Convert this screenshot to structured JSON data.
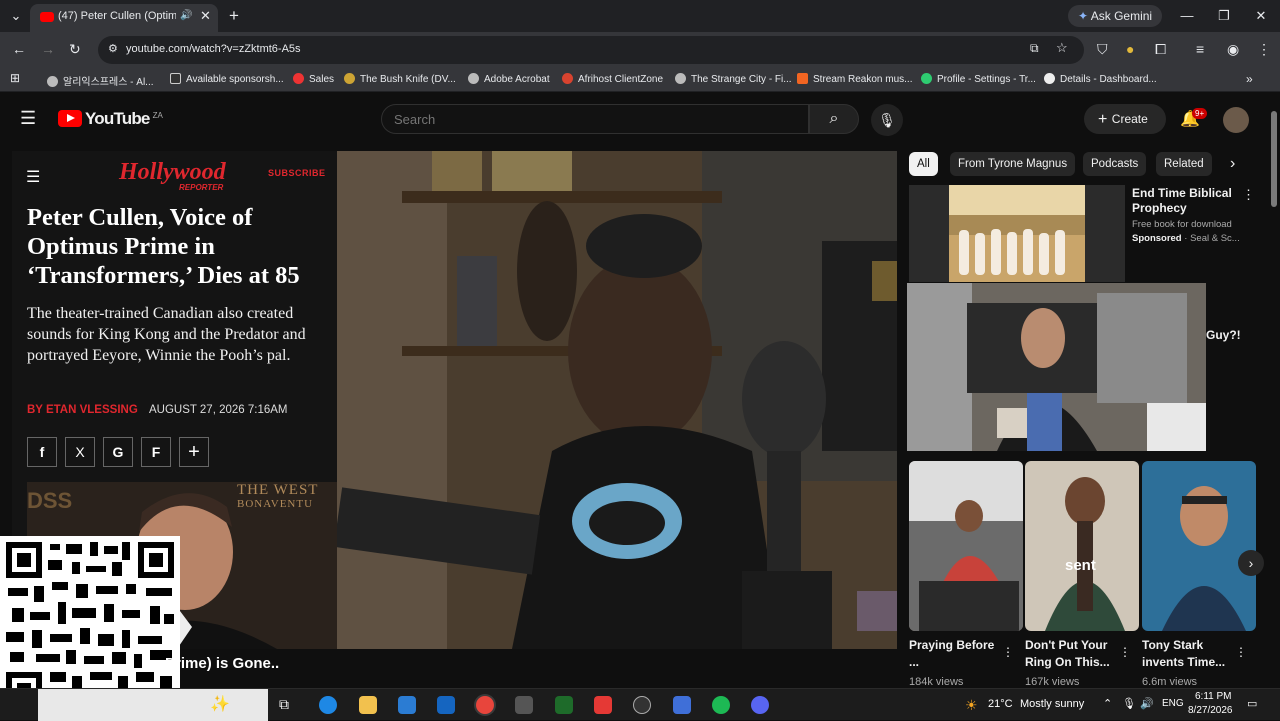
{
  "browser": {
    "tab_title": "(47) Peter Cullen (Optimus",
    "new_tab": "+",
    "ask_gemini": "Ask Gemini",
    "url": "youtube.com/watch?v=zZktmt6-A5s",
    "bookmarks": [
      "알리익스프레스 - Al...",
      "Available sponsorsh...",
      "Sales",
      "The Bush Knife (DV...",
      "Adobe Acrobat",
      "Afrihost ClientZone",
      "The Strange City - Fi...",
      "Stream Reakon mus...",
      "Profile - Settings - Tr...",
      "Details - Dashboard..."
    ]
  },
  "youtube": {
    "logo_word": "YouTube",
    "country": "ZA",
    "search_placeholder": "Search",
    "create_label": "Create",
    "notif_badge": "9+"
  },
  "video": {
    "thr_logo": "The Hollywood Reporter",
    "subscribe": "SUBSCRIBE",
    "headline": "Peter Cullen, Voice of Optimus Prime in ‘Transformers,’ Dies at 85",
    "dek": "The theater-trained Canadian also created sounds for King Kong and the Predator and portrayed Eeyore, Winnie the Pooh’s pal.",
    "byline": "BY ETAN VLESSING",
    "date": "AUGUST 27, 2026 7:16AM",
    "share_icons": [
      "f",
      "X",
      "G",
      "F",
      "+"
    ],
    "photo_sign": "THE WEST",
    "photo_sign2": "BONAVENTU",
    "caption": "Prime) is Gone.."
  },
  "sidebar": {
    "chips": [
      "All",
      "From Tyrone Magnus",
      "Podcasts",
      "Related"
    ],
    "ad": {
      "title": "End Time Biblical Prophecy",
      "subtitle": "Free book for download",
      "sponsored": "Sponsored",
      "advertiser": "· Seal & Sc..."
    },
    "pip_fragment": "Guy?!",
    "shorts": [
      {
        "title": "Praying Before ...",
        "views": "184k views"
      },
      {
        "title": "Don't Put Your Ring On This...",
        "views": "167k views",
        "overlay": "sent"
      },
      {
        "title": "Tony Stark invents Time...",
        "views": "6.6m views"
      }
    ]
  },
  "taskbar": {
    "weather": "21°C",
    "weather_text": "Mostly sunny",
    "lang": "ENG",
    "time": "6:11 PM",
    "date": "8/27/2026"
  }
}
